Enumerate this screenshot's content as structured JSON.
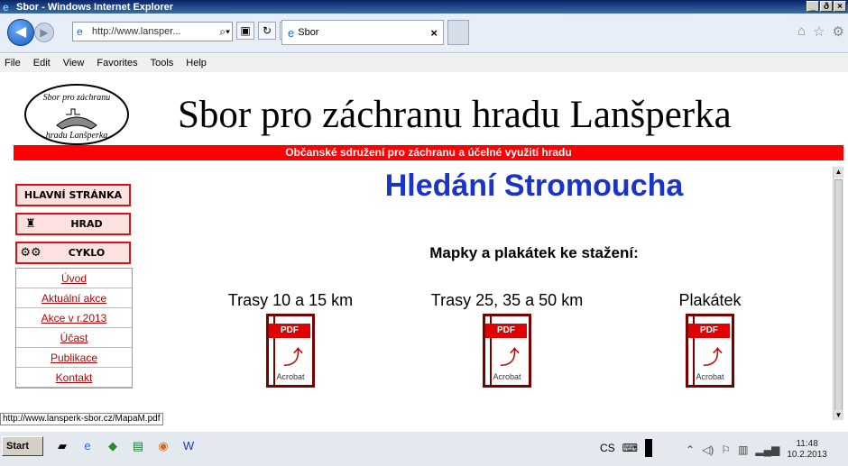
{
  "window": {
    "title": "Sbor - Windows Internet Explorer",
    "buttons": [
      "_",
      "ð",
      "×"
    ]
  },
  "browser": {
    "url": "http://www.lansper...",
    "tab_label": "Sbor",
    "tab_close": "×"
  },
  "menu": [
    "File",
    "Edit",
    "View",
    "Favorites",
    "Tools",
    "Help"
  ],
  "site": {
    "logo_text": "Sbor pro záchranu hradu Lanšperka",
    "title": "Sbor pro záchranu hradu Lanšperka",
    "subtitle": "Občanské sdružení pro záchranu a účelné využití hradu"
  },
  "nav": {
    "home": "HLAVNÍ STRÁNKA",
    "hrad": "HRAD",
    "cyklo": "CYKLO",
    "links": [
      "Úvod",
      "Aktuální akce",
      "Akce v r.2013",
      "Účast",
      "Publikace",
      "Kontakt"
    ]
  },
  "main": {
    "heading": "Hledání Stromoucha",
    "subheading": "Mapky a plakátek ke stažení:",
    "downloads": [
      {
        "label": "Trasy 10 a 15 km",
        "badge": "PDF",
        "brand": "Acrobat"
      },
      {
        "label": "Trasy 25, 35 a 50 km",
        "badge": "PDF",
        "brand": "Acrobat"
      },
      {
        "label": "Plakátek",
        "badge": "PDF",
        "brand": "Acrobat"
      }
    ]
  },
  "status_url": "http://www.lansperk-sbor.cz/MapaM.pdf",
  "taskbar": {
    "start": "Start",
    "lang": "CS",
    "time": "11:48",
    "date": "10.2.2013"
  },
  "colors": {
    "accent_red": "#ff0000",
    "heading_blue": "#1a33c8",
    "link_red": "#c00000"
  },
  "icons": [
    "ie-icon",
    "back-icon",
    "forward-icon",
    "search-icon",
    "home-icon",
    "star-icon",
    "gear-icon",
    "castle-icon",
    "bicycle-icon",
    "pdf-icon"
  ]
}
